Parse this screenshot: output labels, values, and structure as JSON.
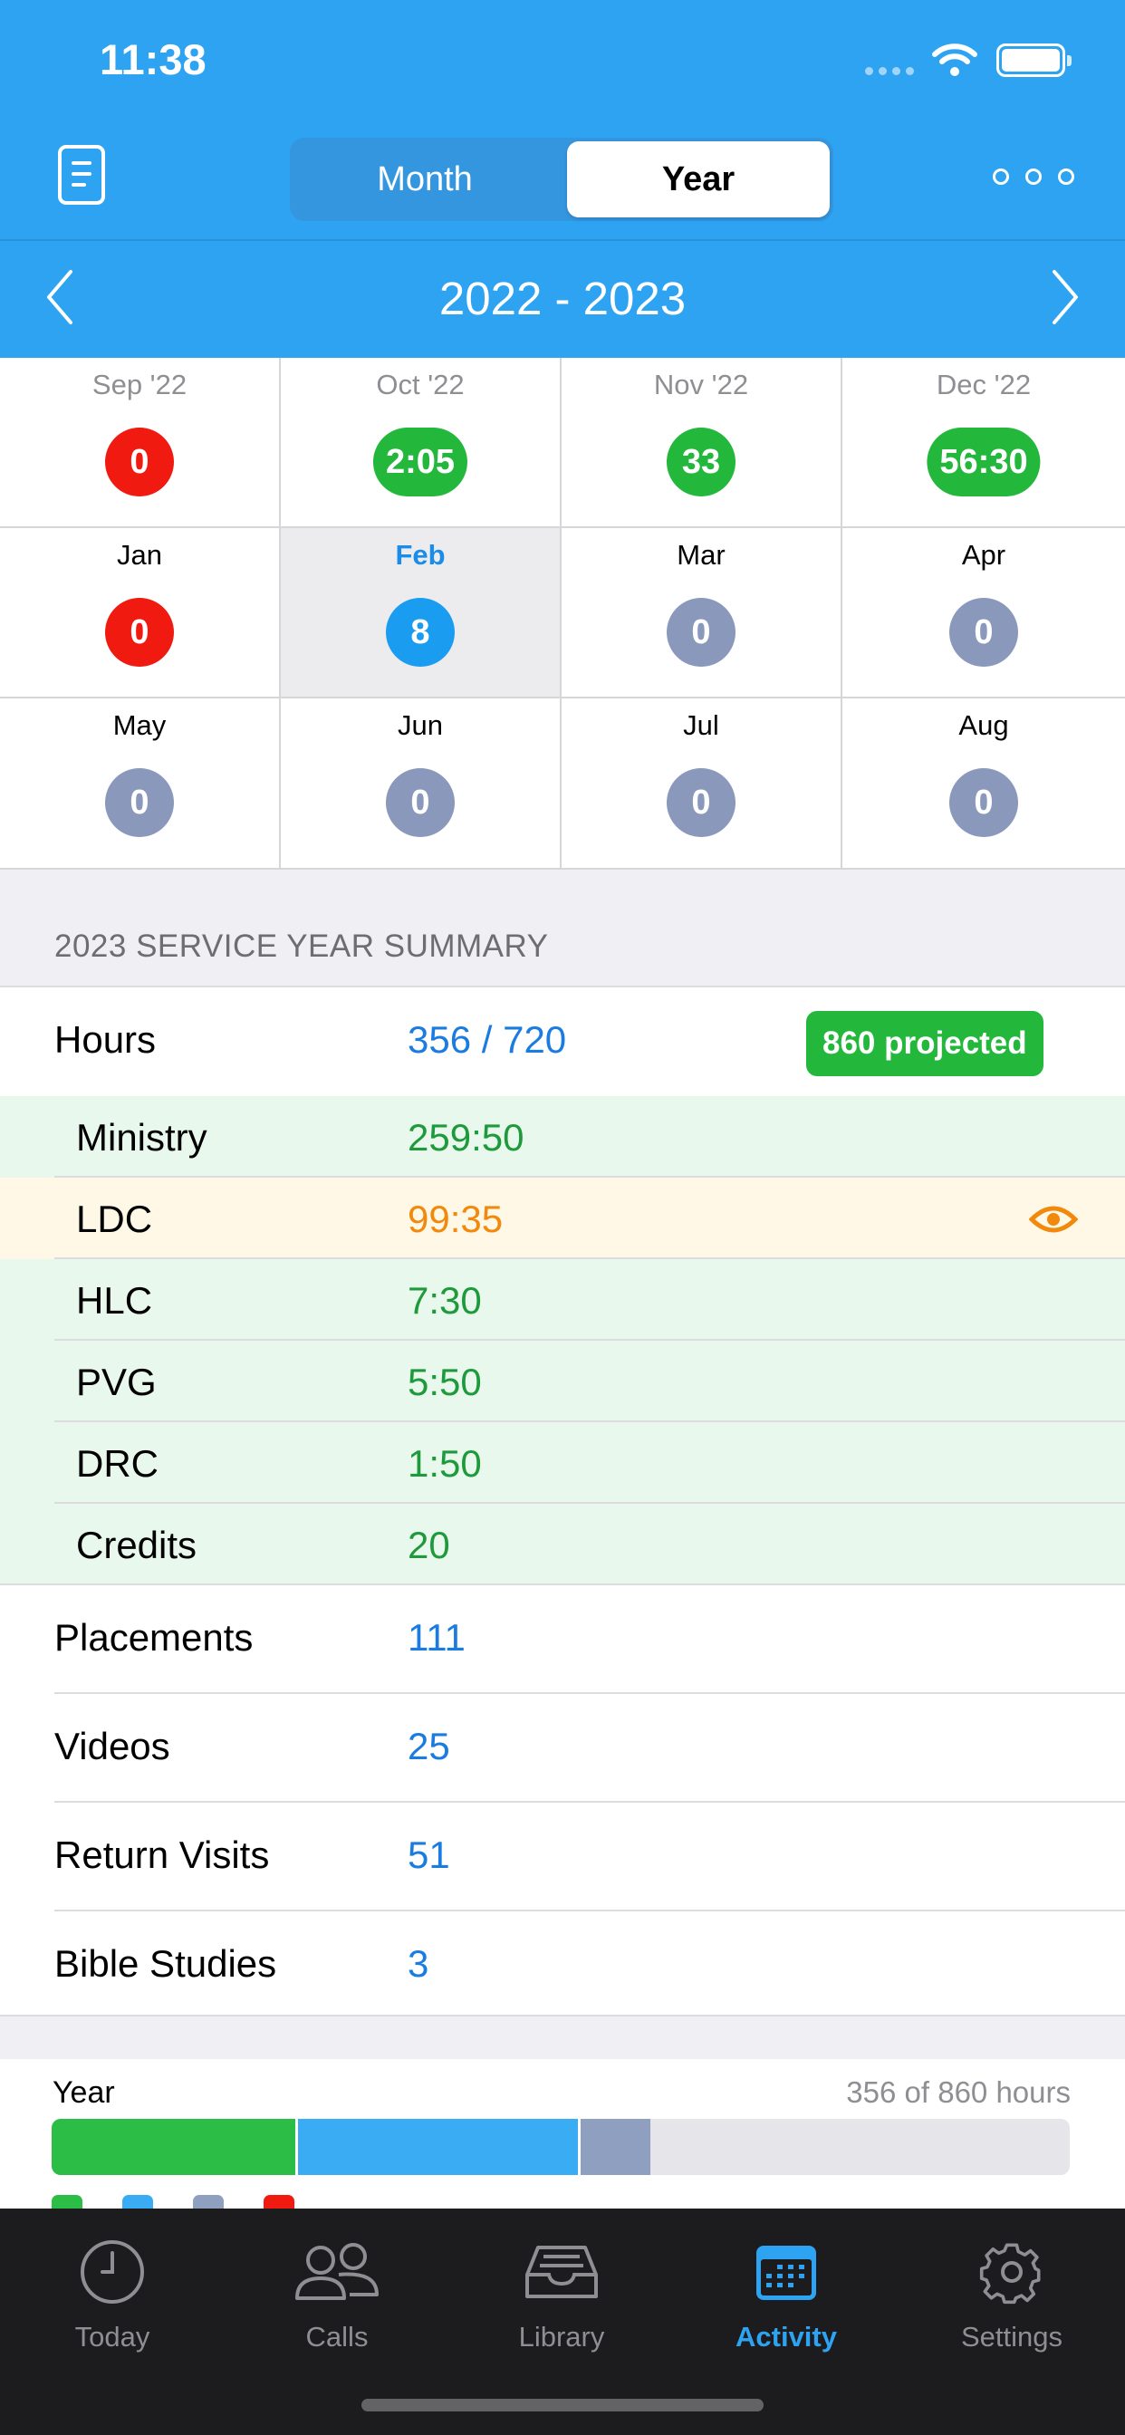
{
  "status_bar": {
    "time": "11:38"
  },
  "header": {
    "segments": {
      "month": "Month",
      "year": "Year",
      "selected": "Year"
    },
    "year_range": "2022 - 2023"
  },
  "months": [
    {
      "label": "Sep '22",
      "value": "0",
      "color": "red",
      "muted": true
    },
    {
      "label": "Oct '22",
      "value": "2:05",
      "color": "green",
      "muted": true
    },
    {
      "label": "Nov '22",
      "value": "33",
      "color": "green",
      "muted": true
    },
    {
      "label": "Dec '22",
      "value": "56:30",
      "color": "green",
      "muted": true
    },
    {
      "label": "Jan",
      "value": "0",
      "color": "red",
      "muted": false
    },
    {
      "label": "Feb",
      "value": "8",
      "color": "blue",
      "muted": false,
      "selected": true
    },
    {
      "label": "Mar",
      "value": "0",
      "color": "gray",
      "muted": false
    },
    {
      "label": "Apr",
      "value": "0",
      "color": "gray",
      "muted": false
    },
    {
      "label": "May",
      "value": "0",
      "color": "gray",
      "muted": false
    },
    {
      "label": "Jun",
      "value": "0",
      "color": "gray",
      "muted": false
    },
    {
      "label": "Jul",
      "value": "0",
      "color": "gray",
      "muted": false
    },
    {
      "label": "Aug",
      "value": "0",
      "color": "gray",
      "muted": false
    }
  ],
  "summary": {
    "header": "2023 SERVICE YEAR SUMMARY",
    "hours": {
      "label": "Hours",
      "value": "356 / 720",
      "projected": "860 projected"
    },
    "breakdown": [
      {
        "label": "Ministry",
        "value": "259:50"
      },
      {
        "label": "LDC",
        "value": "99:35"
      },
      {
        "label": "HLC",
        "value": "7:30"
      },
      {
        "label": "PVG",
        "value": "5:50"
      },
      {
        "label": "DRC",
        "value": "1:50"
      },
      {
        "label": "Credits",
        "value": "20"
      }
    ],
    "counts": [
      {
        "label": "Placements",
        "value": "111"
      },
      {
        "label": "Videos",
        "value": "25"
      },
      {
        "label": "Return Visits",
        "value": "51"
      },
      {
        "label": "Bible Studies",
        "value": "3"
      }
    ]
  },
  "progress": {
    "title": "Year",
    "meta": "356 of 860 hours",
    "segments": [
      {
        "fraction": 0.239,
        "color": "#2bbd45"
      },
      {
        "fraction": 0.275,
        "color": "#3aacf4"
      },
      {
        "fraction": 0.069,
        "color": "#8f9fc0"
      }
    ],
    "legend_colors": [
      "#2bbd45",
      "#3aacf4",
      "#8f9fc0",
      "#f01a10"
    ]
  },
  "tabs": [
    {
      "label": "Today"
    },
    {
      "label": "Calls"
    },
    {
      "label": "Library"
    },
    {
      "label": "Activity",
      "active": true
    },
    {
      "label": "Settings"
    }
  ]
}
